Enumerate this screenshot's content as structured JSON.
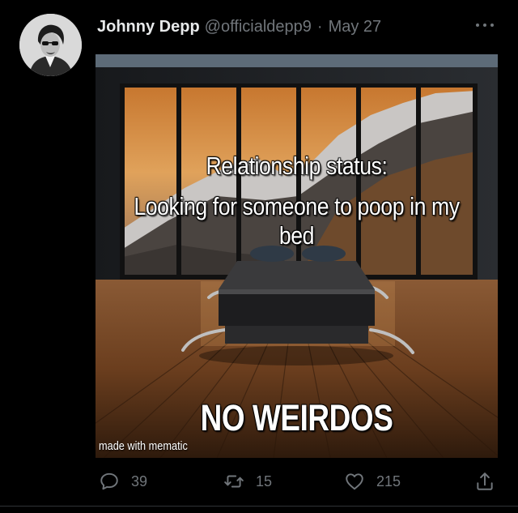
{
  "tweet": {
    "author_name": "Johnny Depp",
    "author_handle": "@officialdepp9",
    "separator": "·",
    "date": "May 27",
    "media": {
      "top_text_line1": "Relationship status:",
      "top_text_line2": "Looking for someone to poop in my bed",
      "bottom_text": "NO WEIRDOS",
      "watermark": "made with mematic"
    },
    "actions": {
      "reply_count": "39",
      "retweet_count": "15",
      "like_count": "215"
    },
    "icons": {
      "reply": "reply-icon",
      "retweet": "retweet-icon",
      "like": "heart-icon",
      "share": "share-icon",
      "more": "more-icon"
    },
    "colors": {
      "background": "#000000",
      "primary_text": "#e7e9ea",
      "secondary_text": "#71767b"
    }
  }
}
